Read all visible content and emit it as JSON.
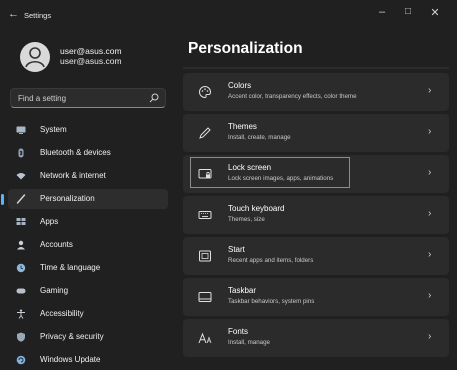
{
  "window": {
    "title": "Settings",
    "back_glyph": "←",
    "minimize_glyph": "–",
    "maximize_glyph": "□",
    "close_glyph": "✕"
  },
  "user": {
    "name": "user@asus.com",
    "email": "user@asus.com"
  },
  "search": {
    "placeholder": "Find a setting",
    "icon": "search-icon"
  },
  "sidebar": {
    "accent_color": "#5fb2f2",
    "items": [
      {
        "label": "System",
        "icon": "display-icon",
        "active": false
      },
      {
        "label": "Bluetooth & devices",
        "icon": "bluetooth-icon",
        "active": false
      },
      {
        "label": "Network & internet",
        "icon": "wifi-icon",
        "active": false
      },
      {
        "label": "Personalization",
        "icon": "brush-icon",
        "active": true
      },
      {
        "label": "Apps",
        "icon": "apps-icon",
        "active": false
      },
      {
        "label": "Accounts",
        "icon": "person-icon",
        "active": false
      },
      {
        "label": "Time & language",
        "icon": "globe-clock-icon",
        "active": false
      },
      {
        "label": "Gaming",
        "icon": "gamepad-icon",
        "active": false
      },
      {
        "label": "Accessibility",
        "icon": "accessibility-icon",
        "active": false
      },
      {
        "label": "Privacy & security",
        "icon": "shield-icon",
        "active": false
      },
      {
        "label": "Windows Update",
        "icon": "update-icon",
        "active": false
      }
    ]
  },
  "main": {
    "title": "Personalization",
    "cards": [
      {
        "title": "Colors",
        "subtitle": "Accent color, transparency effects, color theme",
        "icon": "palette-icon",
        "chevron": "›"
      },
      {
        "title": "Themes",
        "subtitle": "Install, create, manage",
        "icon": "pen-icon",
        "chevron": "›"
      },
      {
        "title": "Lock screen",
        "subtitle": "Lock screen images, apps, animations",
        "icon": "lock-screen-icon",
        "chevron": "›"
      },
      {
        "title": "Touch keyboard",
        "subtitle": "Themes, size",
        "icon": "keyboard-icon",
        "chevron": "›"
      },
      {
        "title": "Start",
        "subtitle": "Recent apps and items, folders",
        "icon": "start-icon",
        "chevron": "›"
      },
      {
        "title": "Taskbar",
        "subtitle": "Taskbar behaviors, system pins",
        "icon": "taskbar-icon",
        "chevron": "›"
      },
      {
        "title": "Fonts",
        "subtitle": "Install, manage",
        "icon": "fonts-icon",
        "chevron": "›"
      }
    ]
  }
}
